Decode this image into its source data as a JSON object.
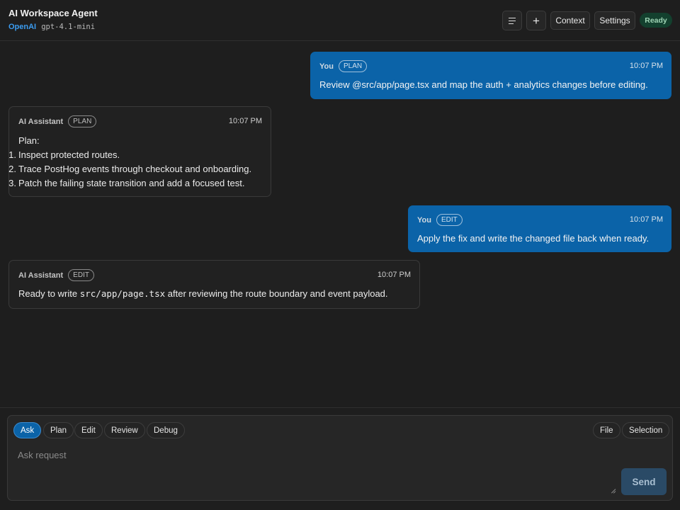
{
  "header": {
    "title": "AI Workspace Agent",
    "provider": "OpenAI",
    "model": "gpt-4.1-mini",
    "buttons": {
      "menu_icon": "menu-icon",
      "new_icon": "plus-icon",
      "plus_glyph": "+",
      "context": "Context",
      "settings": "Settings"
    },
    "status": "Ready"
  },
  "messages": [
    {
      "role": "user",
      "sender": "You",
      "badge": "PLAN",
      "time": "10:07 PM",
      "text": "Review @src/app/page.tsx and map the auth + analytics changes before editing."
    },
    {
      "role": "assistant",
      "sender": "AI Assistant",
      "badge": "PLAN",
      "time": "10:07 PM",
      "intro": "Plan:",
      "steps": [
        {
          "num": "1.",
          "text": "Inspect protected routes."
        },
        {
          "num": "2.",
          "text": "Trace PostHog events through checkout and onboarding."
        },
        {
          "num": "3.",
          "text": "Patch the failing state transition and add a focused test."
        }
      ]
    },
    {
      "role": "user",
      "sender": "You",
      "badge": "EDIT",
      "time": "10:07 PM",
      "text": "Apply the fix and write the changed file back when ready."
    },
    {
      "role": "assistant",
      "sender": "AI Assistant",
      "badge": "EDIT",
      "time": "10:07 PM",
      "text_before": "Ready to write",
      "code": "src/app/page.tsx",
      "text_after": "after reviewing the route boundary and event payload."
    }
  ],
  "composer": {
    "modes": [
      "Ask",
      "Plan",
      "Edit",
      "Review",
      "Debug"
    ],
    "active_mode": "Ask",
    "attach": [
      "File",
      "Selection"
    ],
    "placeholder": "Ask request",
    "send_label": "Send"
  },
  "colors": {
    "background": "#1e1e1e",
    "user_bubble": "#0b63a8",
    "assistant_bubble": "#212121",
    "provider": "#3b9cf0",
    "status_bg": "#13402e",
    "send_disabled": "#2a4a66"
  }
}
